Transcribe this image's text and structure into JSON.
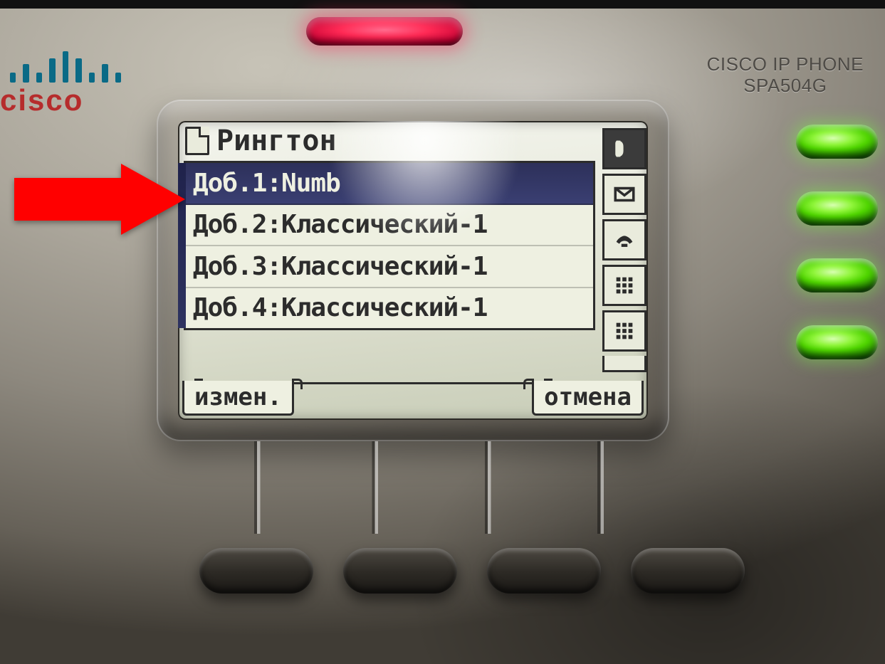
{
  "brand": {
    "name": "cisco",
    "model_line1": "CISCO IP PHONE",
    "model_line2": "SPA504G"
  },
  "screen": {
    "title": "Рингтон",
    "items": [
      {
        "num": "1",
        "text": "Доб.1:Numb",
        "selected": true
      },
      {
        "num": "2",
        "text": "Доб.2:Классический-1",
        "selected": false
      },
      {
        "num": "3",
        "text": "Доб.3:Классический-1",
        "selected": false
      },
      {
        "num": "4",
        "text": "Доб.4:Классический-1",
        "selected": false
      }
    ],
    "side_icons": [
      "phone-handset-icon",
      "envelope-icon",
      "phone-onhook-icon",
      "grid-icon",
      "grid-icon"
    ],
    "softkeys": {
      "left": "измен.",
      "right": "отмена"
    }
  },
  "leds": {
    "message": "on-red",
    "lines": [
      "on-green",
      "on-green",
      "on-green",
      "on-green"
    ]
  },
  "annotation": {
    "arrow_points_to": "menu item 1"
  }
}
